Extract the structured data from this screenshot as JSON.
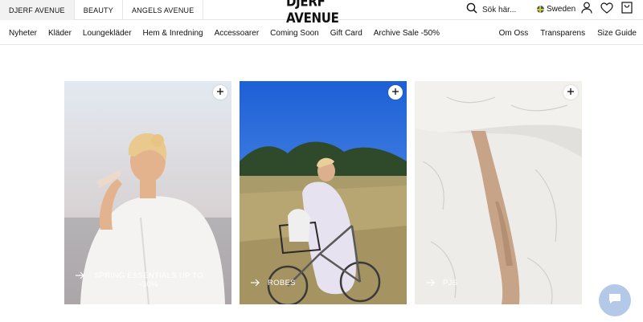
{
  "brand_tabs": [
    "DJERF AVENUE",
    "BEAUTY",
    "ANGELS AVENUE"
  ],
  "logo": "DJERF AVENUE",
  "search": {
    "placeholder": "Sök här..."
  },
  "country": "Sweden",
  "icons": {
    "search": "search-icon",
    "account": "user-icon",
    "wishlist": "heart-icon",
    "cart": "bag-icon",
    "add": "plus-icon",
    "arrow": "arrow-right-icon",
    "chat": "chat-icon"
  },
  "nav_left": [
    "Nyheter",
    "Kläder",
    "Loungekläder",
    "Hem & Inredning",
    "Accessoarer",
    "Coming Soon",
    "Gift Card",
    "Archive Sale -50%"
  ],
  "nav_right": [
    "Om Oss",
    "Transparens",
    "Size Guide"
  ],
  "cards": [
    {
      "caption": "SPRING ESSENTIALS UP TO -30%"
    },
    {
      "caption": "ROBES"
    },
    {
      "caption": "PJS"
    }
  ],
  "colors": {
    "chat_bubble": "#b4c8e8",
    "active_tab": "#f2f2f2"
  }
}
